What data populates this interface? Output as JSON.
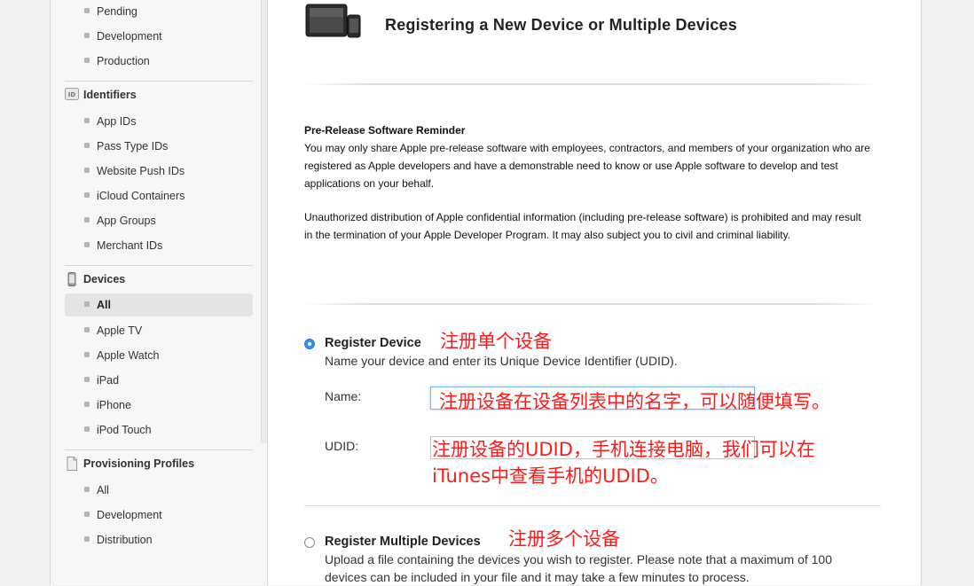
{
  "sidebar": {
    "certificates_items": [
      "Pending",
      "Development",
      "Production"
    ],
    "identifiers": {
      "heading": "Identifiers",
      "icon_text": "ID",
      "items": [
        "App IDs",
        "Pass Type IDs",
        "Website Push IDs",
        "iCloud Containers",
        "App Groups",
        "Merchant IDs"
      ]
    },
    "devices": {
      "heading": "Devices",
      "items": [
        "All",
        "Apple TV",
        "Apple Watch",
        "iPad",
        "iPhone",
        "iPod Touch"
      ],
      "selected": "All"
    },
    "profiles": {
      "heading": "Provisioning Profiles",
      "items": [
        "All",
        "Development",
        "Distribution"
      ]
    }
  },
  "main": {
    "title": "Registering a New Device or Multiple Devices",
    "notice": {
      "title": "Pre-Release Software Reminder",
      "para1": "You may only share Apple pre-release software with employees, contractors, and members of your organization who are registered as Apple developers and have a demonstrable need to know or use Apple software to develop and test applications on your behalf.",
      "para2": "Unauthorized distribution of Apple confidential information (including pre-release software) is prohibited and may result in the termination of your Apple Developer Program. It may also subject you to civil and criminal liability."
    },
    "register_device": {
      "title": "Register Device",
      "desc": "Name your device and enter its Unique Device Identifier (UDID).",
      "name_label": "Name:",
      "udid_label": "UDID:",
      "selected": true
    },
    "register_multiple": {
      "title": "Register Multiple Devices",
      "desc": "Upload a file containing the devices you wish to register. Please note that a maximum of 100 devices can be included in your file and it may take a few minutes to process.",
      "selected": false
    }
  },
  "annotations": {
    "single": "注册单个设备",
    "name_hint": "注册设备在设备列表中的名字，可以随便填写。",
    "udid_hint_line1": "注册设备的UDID，手机连接电脑，我们可以在",
    "udid_hint_line2": "iTunes中查看手机的UDID。",
    "multiple": "注册多个设备"
  },
  "colors": {
    "accent": "#3b8ee6",
    "annotation": "#ff1a1a"
  }
}
